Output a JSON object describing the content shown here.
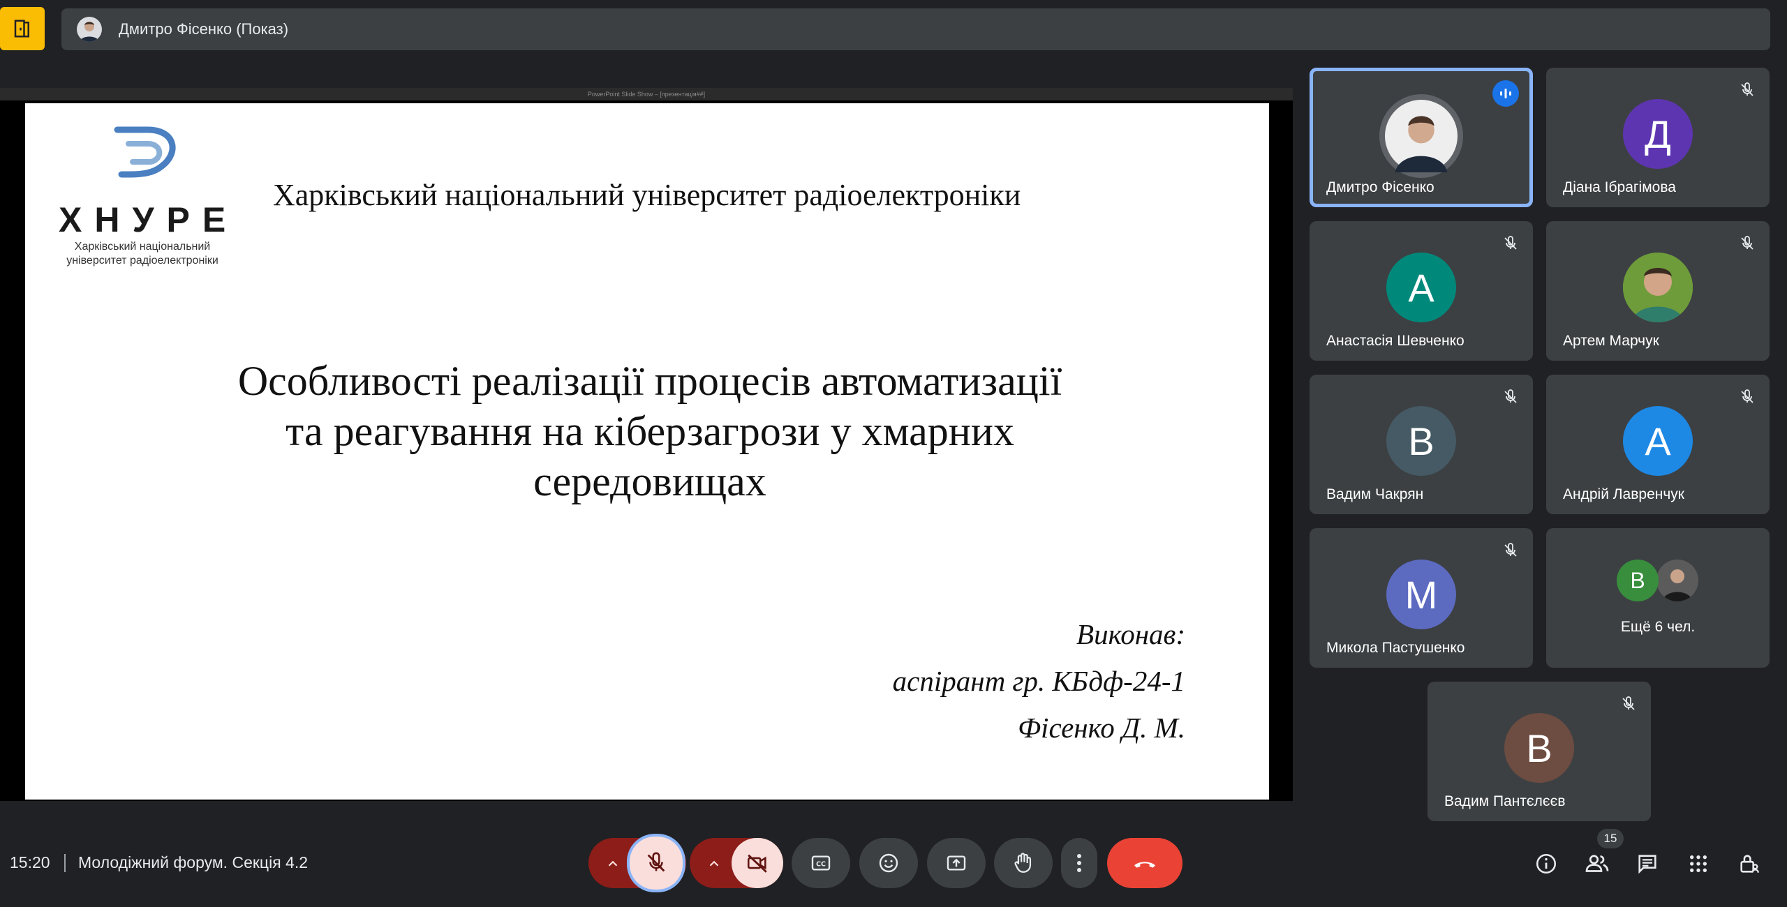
{
  "top_bar": {
    "presenter_label": "Дмитро Фісенко (Показ)"
  },
  "slide": {
    "window_title": "PowerPoint Slide Show – [презентація##]",
    "logo_text": "ХНУРЕ",
    "logo_subtitle": "Харківський національний університет радіоелектроніки",
    "university_title": "Харківський національний університет радіоелектроніки",
    "title_lines": [
      "Особливості реалізації процесів автоматизації",
      "та реагування на кіберзагрози у хмарних",
      "середовищах"
    ],
    "author_lines": [
      "Виконав:",
      "аспірант гр. КБдф-24-1",
      "Фісенко Д. М."
    ]
  },
  "participants": [
    {
      "name": "Дмитро Фісенко",
      "initial": "",
      "color": "#5f6368",
      "speaking": true
    },
    {
      "name": "Діана Ібрагімова",
      "initial": "Д",
      "color": "#5e35b1",
      "speaking": false
    },
    {
      "name": "Анастасія Шевченко",
      "initial": "А",
      "color": "#00897b",
      "speaking": false
    },
    {
      "name": "Артем Марчук",
      "initial": "",
      "color": "#7cb342",
      "speaking": false
    },
    {
      "name": "Вадим Чакрян",
      "initial": "В",
      "color": "#455a64",
      "speaking": false
    },
    {
      "name": "Андрій Лавренчук",
      "initial": "А",
      "color": "#1e88e5",
      "speaking": false
    },
    {
      "name": "Микола Пастушенко",
      "initial": "М",
      "color": "#5c6bc0",
      "speaking": false
    },
    {
      "name": "Вадим Пантєлєєв",
      "initial": "В",
      "color": "#6d4c41",
      "speaking": false
    }
  ],
  "more_tile": {
    "label": "Ещё 6 чел.",
    "initial": "В",
    "color": "#388e3c"
  },
  "bottom_bar": {
    "time": "15:20",
    "meeting_title": "Молодіжний форум. Секція 4.2",
    "participant_count": "15"
  },
  "colors": {
    "background": "#202124",
    "tile": "#3c4043",
    "accent_blue": "#8ab4f8",
    "end_call": "#ea4335",
    "logo_yellow": "#fbbc04"
  }
}
